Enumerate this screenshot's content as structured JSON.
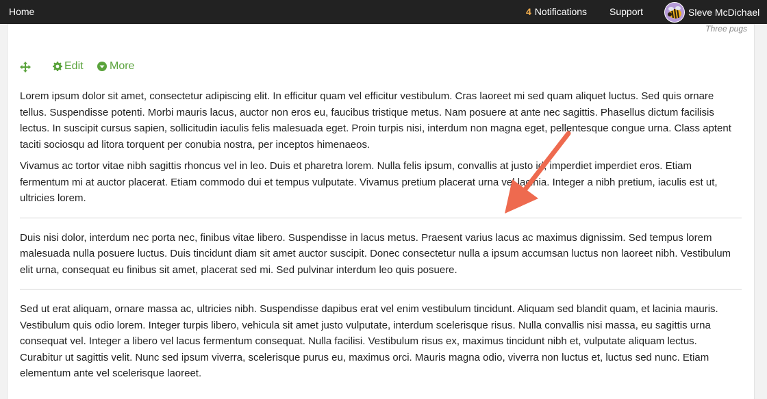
{
  "topbar": {
    "home_label": "Home",
    "notifications_count": "4",
    "notifications_label": "Notifications",
    "support_label": "Support",
    "user_name": "Sleve McDichael",
    "avatar_icon": "bee-avatar-icon"
  },
  "panel": {
    "caption": "Three pugs"
  },
  "toolbar": {
    "move_icon": "move-arrows-icon",
    "edit_label": "Edit",
    "more_label": "More",
    "accent_color": "#5aa33c"
  },
  "content": {
    "paragraphs": [
      "Lorem ipsum dolor sit amet, consectetur adipiscing elit. In efficitur quam vel efficitur vestibulum. Cras laoreet mi sed quam aliquet luctus. Sed quis ornare tellus. Suspendisse potenti. Morbi mauris lacus, auctor non eros eu, faucibus tristique metus. Nam posuere at ante nec sagittis. Phasellus dictum facilisis lectus. In suscipit cursus sapien, sollicitudin iaculis felis malesuada eget. Proin turpis nisi, interdum non magna eget, pellentesque congue urna. Class aptent taciti sociosqu ad litora torquent per conubia nostra, per inceptos himenaeos.",
      "Vivamus ac tortor vitae nibh sagittis rhoncus vel in leo. Duis et pharetra lorem. Nulla felis ipsum, convallis at justo id, imperdiet imperdiet eros. Etiam fermentum mi at auctor placerat. Etiam commodo dui et tempus vulputate. Vivamus pretium placerat urna vel lacinia. Integer a nibh pretium, iaculis est ut, ultricies lorem.",
      "Duis nisi dolor, interdum nec porta nec, finibus vitae libero. Suspendisse in lacus metus. Praesent varius lacus ac maximus dignissim. Sed tempus lorem malesuada nulla posuere luctus. Duis tincidunt diam sit amet auctor suscipit. Donec consectetur nulla a ipsum accumsan luctus non laoreet nibh. Vestibulum elit urna, consequat eu finibus sit amet, placerat sed mi. Sed pulvinar interdum leo quis posuere.",
      "Sed ut erat aliquam, ornare massa ac, ultricies nibh. Suspendisse dapibus erat vel enim vestibulum tincidunt. Aliquam sed blandit quam, et lacinia mauris. Vestibulum quis odio lorem. Integer turpis libero, vehicula sit amet justo vulputate, interdum scelerisque risus. Nulla convallis nisi massa, eu sagittis urna consequat vel. Integer a libero vel lacus fermentum consequat. Nulla facilisi. Vestibulum risus ex, maximus tincidunt nibh et, vulputate aliquam lectus. Curabitur ut sagittis velit. Nunc sed ipsum viverra, scelerisque purus eu, maximus orci. Mauris magna odio, viverra non luctus et, luctus sed nunc. Etiam elementum ante vel scelerisque laoreet."
    ]
  },
  "annotation": {
    "arrow_color": "#ee6a4f"
  }
}
